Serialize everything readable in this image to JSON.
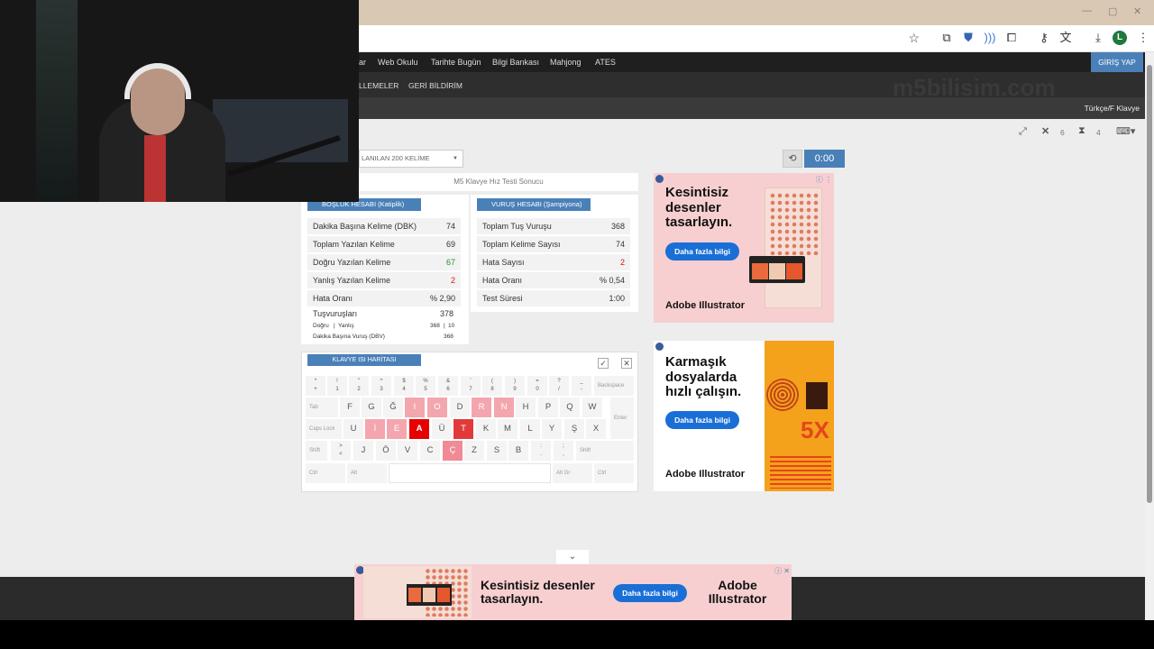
{
  "browser": {
    "toolbar_icons": [
      "star-icon",
      "extension-icon",
      "profile-icon",
      "audio-icon",
      "puzzle-icon",
      "key-icon",
      "translate-icon",
      "download-icon",
      "avatar",
      "menu-icon"
    ],
    "avatar_letter": "L"
  },
  "nav": {
    "items": [
      "ar",
      "Web Okulu",
      "Tarihte Bugün",
      "Bilgi Bankası",
      "Mahjong",
      "ATES"
    ],
    "login": "GİRİŞ YAP",
    "sub_items": [
      "LLEMELER",
      "GERİ BİLDİRİM"
    ],
    "watermark": "m5bilisim.com",
    "keyboard_layout": "Türkçe/F Klavye"
  },
  "toolbar": {
    "expand_icon": "expand-icon",
    "errors_count": "6",
    "hourglass_count": "4"
  },
  "word_select": "LANILAN 200 KELİME",
  "timer": "0:00",
  "result": {
    "title": "M5 Klavye Hız Testi Sonucu",
    "left_tag": "BOŞLUK HESABI (Katiplik)",
    "right_tag": "VURUŞ HESABI (Şampiyona)",
    "left_rows": [
      {
        "label": "Dakika Başına Kelime (DBK)",
        "value": "74"
      },
      {
        "label": "Toplam Yazılan Kelime",
        "value": "69"
      },
      {
        "label": "Doğru Yazılan Kelime",
        "value": "67"
      },
      {
        "label": "Yanlış Yazılan Kelime",
        "value": "2"
      },
      {
        "label": "Hata Oranı",
        "value": "% 2,90"
      }
    ],
    "keystrokes_label": "Tuşvuruşları",
    "keystrokes_value": "378",
    "correct_label": "Doğru",
    "sep": "|",
    "wrong_label": "Yanlış",
    "correct_value": "368",
    "wrong_value": "10",
    "dbv_label": "Dakika Başına Vuruş (DBV)",
    "dbv_value": "368",
    "right_rows": [
      {
        "label": "Toplam Tuş Vuruşu",
        "value": "368"
      },
      {
        "label": "Toplam Kelime Sayısı",
        "value": "74"
      },
      {
        "label": "Hata Sayısı",
        "value": "2"
      },
      {
        "label": "Hata Oranı",
        "value": "% 0,54"
      },
      {
        "label": "Test Süresi",
        "value": "1:00"
      }
    ]
  },
  "keyboard": {
    "tag": "KLAVYE ISI HARİTASI",
    "row1": [
      {
        "top": "*",
        "bottom": "+"
      },
      {
        "top": "!",
        "bottom": "1"
      },
      {
        "top": "\"",
        "bottom": "2"
      },
      {
        "top": "^",
        "bottom": "3"
      },
      {
        "top": "$",
        "bottom": "4"
      },
      {
        "top": "%",
        "bottom": "5"
      },
      {
        "top": "&",
        "bottom": "6"
      },
      {
        "top": "'",
        "bottom": "7"
      },
      {
        "top": "(",
        "bottom": "8"
      },
      {
        "top": ")",
        "bottom": "9"
      },
      {
        "top": "=",
        "bottom": "0"
      },
      {
        "top": "?",
        "bottom": "/"
      },
      {
        "top": "_",
        "bottom": "-"
      }
    ],
    "backspace": "Backspace",
    "tab": "Tab",
    "row2": [
      "F",
      "G",
      "Ğ",
      "I",
      "O",
      "D",
      "R",
      "N",
      "H",
      "P",
      "Q",
      "W"
    ],
    "enter": "Enter",
    "caps": "Caps Lock",
    "row3": [
      "U",
      "İ",
      "E",
      "A",
      "Ü",
      "T",
      "K",
      "M",
      "L",
      "Y",
      "Ş",
      "X"
    ],
    "shift": "Shift",
    "row4_first_top": ">",
    "row4_first_bottom": "<",
    "row4": [
      "J",
      "Ö",
      "V",
      "C",
      "Ç",
      "Z",
      "S",
      "B"
    ],
    "row4_extra1_top": ":",
    "row4_extra1_bottom": ".",
    "row4_extra2_top": ";",
    "row4_extra2_bottom": ",",
    "shift_right": "Shift",
    "ctrl": "Ctrl",
    "alt": "Alt",
    "altgr": "Alt Gr",
    "ctrl_right": "Ctrl"
  },
  "ads": {
    "ad1": {
      "headline": "Kesintisiz desenler tasarlayın.",
      "cta": "Daha fazla bilgi",
      "brand": "Adobe Illustrator"
    },
    "ad2": {
      "headline": "Karmaşık dosyalarda hızlı çalışın.",
      "cta": "Daha fazla bilgi",
      "brand": "Adobe Illustrator",
      "big_text": "5X"
    },
    "ad3": {
      "headline": "Kesintisiz desenler tasarlayın.",
      "cta": "Daha fazla bilgi",
      "brand_line1": "Adobe",
      "brand_line2": "Illustrator"
    }
  }
}
